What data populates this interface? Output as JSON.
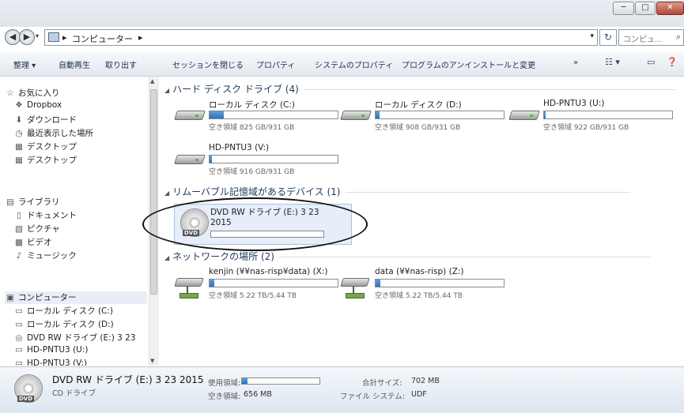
{
  "address": {
    "crumbs": [
      "コンピューター"
    ],
    "separator": "▸",
    "search_placeholder": "コンピュ..."
  },
  "toolbar": {
    "items": [
      "整理 ▾",
      "自動再生",
      "取り出す",
      "セッションを閉じる",
      "プロパティ",
      "システムのプロパティ",
      "プログラムのアンインストールと変更",
      "»"
    ]
  },
  "sidebar": {
    "favorites_header": "お気に入り",
    "favorites": [
      "Dropbox",
      "ダウンロード",
      "最近表示した場所",
      "デスクトップ",
      "デスクトップ"
    ],
    "libraries_header": "ライブラリ",
    "libraries": [
      "ドキュメント",
      "ピクチャ",
      "ビデオ",
      "ミュージック"
    ],
    "computer_header": "コンピューター",
    "computer": [
      "ローカル ディスク (C:)",
      "ローカル ディスク (D:)",
      "DVD RW ドライブ (E:) 3 23",
      "HD-PNTU3 (U:)",
      "HD-PNTU3 (V:)"
    ]
  },
  "groups": {
    "hdd": "ハード ディスク ドライブ (4)",
    "removable": "リムーバブル記憶域があるデバイス (1)",
    "network": "ネットワークの場所 (2)"
  },
  "drives": [
    {
      "name": "ローカル ディスク (C:)",
      "free": "空き領域 825 GB/931 GB",
      "used_fraction": 0.11
    },
    {
      "name": "ローカル ディスク (D:)",
      "free": "空き領域 908 GB/931 GB",
      "used_fraction": 0.03
    },
    {
      "name": "HD-PNTU3 (U:)",
      "free": "空き領域 922 GB/931 GB",
      "used_fraction": 0.01
    },
    {
      "name": "HD-PNTU3 (V:)",
      "free": "空き領域 916 GB/931 GB",
      "used_fraction": 0.02
    }
  ],
  "dvd": {
    "name_line1": "DVD RW ドライブ (E:) 3 23",
    "name_line2": "2015",
    "tag": "DVD"
  },
  "network_drives": [
    {
      "name": "kenjin (¥¥nas-risp¥data) (X:)",
      "free": "空き領域 5.22 TB/5.44 TB",
      "used_fraction": 0.04
    },
    {
      "name": "data (¥¥nas-risp) (Z:)",
      "free": "空き領域 5.22 TB/5.44 TB",
      "used_fraction": 0.04
    }
  ],
  "details": {
    "title": "DVD RW ドライブ (E:) 3 23 2015",
    "subtitle": "CD ドライブ",
    "used_label": "使用領域:",
    "free_label": "空き領域:",
    "free_value": "656 MB",
    "total_label": "合計サイズ:",
    "total_value": "702 MB",
    "fs_label": "ファイル システム:",
    "fs_value": "UDF",
    "used_fraction": 0.07
  },
  "window_buttons": {
    "min": "─",
    "max": "□",
    "close": "✕"
  }
}
